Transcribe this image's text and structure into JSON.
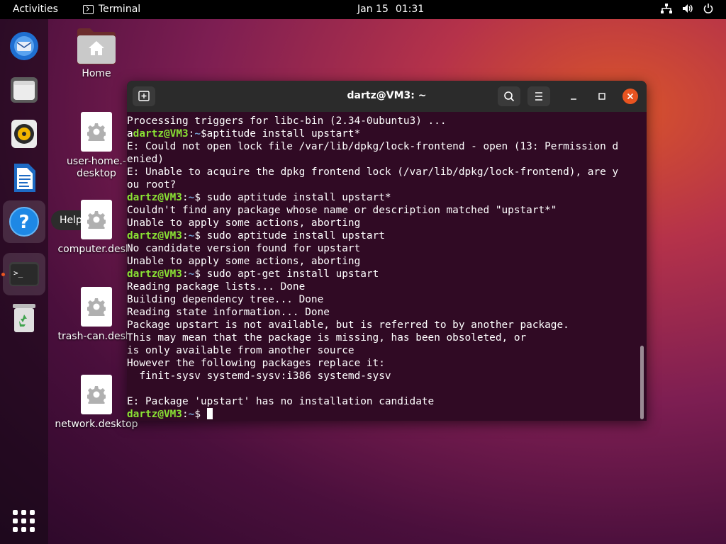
{
  "topbar": {
    "activities": "Activities",
    "app_name": "Terminal",
    "date": "Jan 15",
    "time": "01:31",
    "status_icons": [
      "network-icon",
      "volume-icon",
      "power-icon"
    ]
  },
  "dock": {
    "items": [
      {
        "name": "thunderbird",
        "icon": "mail-client-icon"
      },
      {
        "name": "files",
        "icon": "folder-icon"
      },
      {
        "name": "rhythmbox",
        "icon": "music-player-icon"
      },
      {
        "name": "writer",
        "icon": "document-writer-icon"
      },
      {
        "name": "help",
        "icon": "help-icon"
      },
      {
        "name": "terminal",
        "icon": "terminal-icon",
        "active": true
      },
      {
        "name": "trash",
        "icon": "trash-icon"
      }
    ],
    "tooltip": "Help",
    "apps_button": "show-applications-icon"
  },
  "desktop": {
    "icons": [
      {
        "label": "Home"
      },
      {
        "label": "user-home.-\ndesktop"
      },
      {
        "label": "computer.deskt"
      },
      {
        "label": "trash-can.deskt"
      },
      {
        "label": "network.desktop"
      }
    ]
  },
  "terminal": {
    "title": "dartz@VM3: ~",
    "user": "dartz@VM3",
    "lines": [
      {
        "text": "Processing triggers for libc-bin (2.34-0ubuntu3) ..."
      },
      {
        "pre": "a",
        "prompt": true,
        "cmd": "$aptitude install upstart*"
      },
      {
        "text": "E: Could not open lock file /var/lib/dpkg/lock-frontend - open (13: Permission d"
      },
      {
        "text": "enied)"
      },
      {
        "text": "E: Unable to acquire the dpkg frontend lock (/var/lib/dpkg/lock-frontend), are y"
      },
      {
        "text": "ou root?"
      },
      {
        "prompt": true,
        "cmd": "$ sudo aptitude install upstart*"
      },
      {
        "text": "Couldn't find any package whose name or description matched \"upstart*\""
      },
      {
        "text": "Unable to apply some actions, aborting"
      },
      {
        "prompt": true,
        "cmd": "$ sudo aptitude install upstart"
      },
      {
        "text": "No candidate version found for upstart"
      },
      {
        "text": "Unable to apply some actions, aborting"
      },
      {
        "prompt": true,
        "cmd": "$ sudo apt-get install upstart"
      },
      {
        "text": "Reading package lists... Done"
      },
      {
        "text": "Building dependency tree... Done"
      },
      {
        "text": "Reading state information... Done"
      },
      {
        "text": "Package upstart is not available, but is referred to by another package."
      },
      {
        "text": "This may mean that the package is missing, has been obsoleted, or"
      },
      {
        "text": "is only available from another source"
      },
      {
        "text": "However the following packages replace it:"
      },
      {
        "text": "  finit-sysv systemd-sysv:i386 systemd-sysv"
      },
      {
        "text": ""
      },
      {
        "text": "E: Package 'upstart' has no installation candidate"
      },
      {
        "prompt": true,
        "cmd": "$ ",
        "cursor": true
      }
    ],
    "prompt_sep": ":",
    "prompt_path": "~"
  },
  "colors": {
    "terminal_bg": "#300a24",
    "prompt_user": "#8ae234",
    "prompt_path": "#729fcf",
    "accent": "#e95420"
  }
}
